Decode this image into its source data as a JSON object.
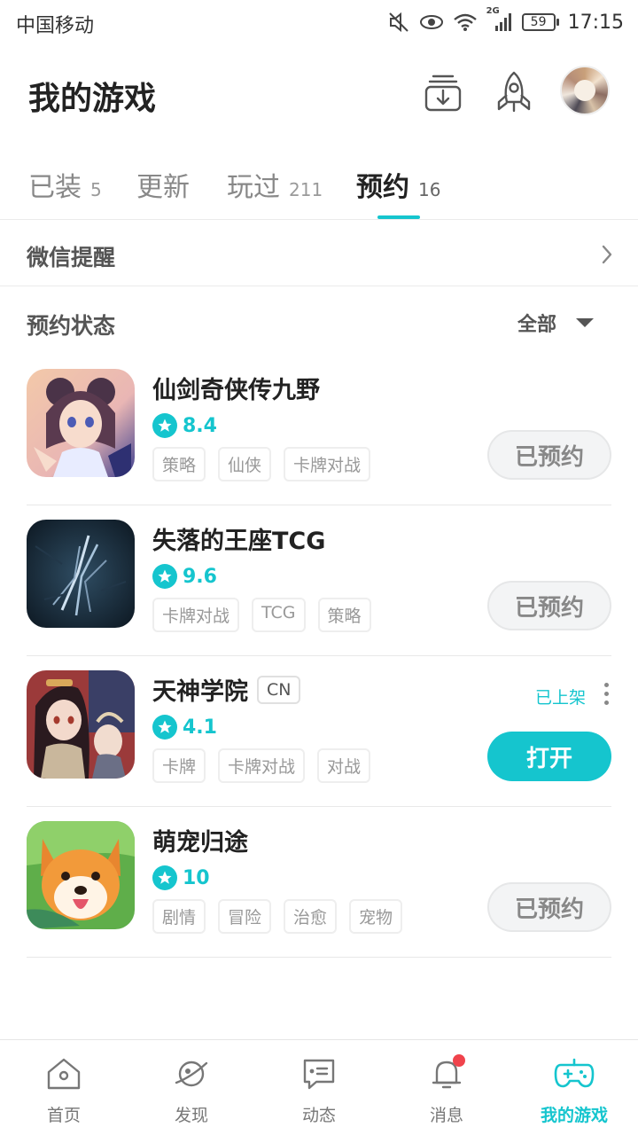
{
  "status_bar": {
    "carrier": "中国移动",
    "signal_label": "2G",
    "battery": "59",
    "time": "17:15"
  },
  "header": {
    "title": "我的游戏",
    "icons": [
      "download-manager-icon",
      "rocket-icon",
      "avatar"
    ]
  },
  "tabs": [
    {
      "label": "已装",
      "count": "5"
    },
    {
      "label": "更新",
      "count": ""
    },
    {
      "label": "玩过",
      "count": "211"
    },
    {
      "label": "预约",
      "count": "16",
      "active": true
    }
  ],
  "wechat_reminder": {
    "label": "微信提醒"
  },
  "filter": {
    "title": "预约状态",
    "value": "全部"
  },
  "games": [
    {
      "name": "仙剑奇侠传九野",
      "rating": "8.4",
      "tags": [
        "策略",
        "仙侠",
        "卡牌对战"
      ],
      "action": "已预约"
    },
    {
      "name": "失落的王座TCG",
      "rating": "9.6",
      "tags": [
        "卡牌对战",
        "TCG",
        "策略"
      ],
      "action": "已预约"
    },
    {
      "name": "天神学院",
      "region": "CN",
      "status": "已上架",
      "rating": "4.1",
      "tags": [
        "卡牌",
        "卡牌对战",
        "对战"
      ],
      "action": "打开"
    },
    {
      "name": "萌宠归途",
      "rating": "10",
      "tags": [
        "剧情",
        "冒险",
        "治愈",
        "宠物"
      ],
      "action": "已预约"
    }
  ],
  "bottom_nav": [
    {
      "label": "首页",
      "icon": "home-icon"
    },
    {
      "label": "发现",
      "icon": "planet-icon"
    },
    {
      "label": "动态",
      "icon": "message-icon"
    },
    {
      "label": "消息",
      "icon": "bell-icon",
      "has_dot": true
    },
    {
      "label": "我的游戏",
      "icon": "gamepad-icon",
      "active": true
    }
  ],
  "colors": {
    "accent": "#15c5ce",
    "notification_dot": "#f0434c"
  }
}
